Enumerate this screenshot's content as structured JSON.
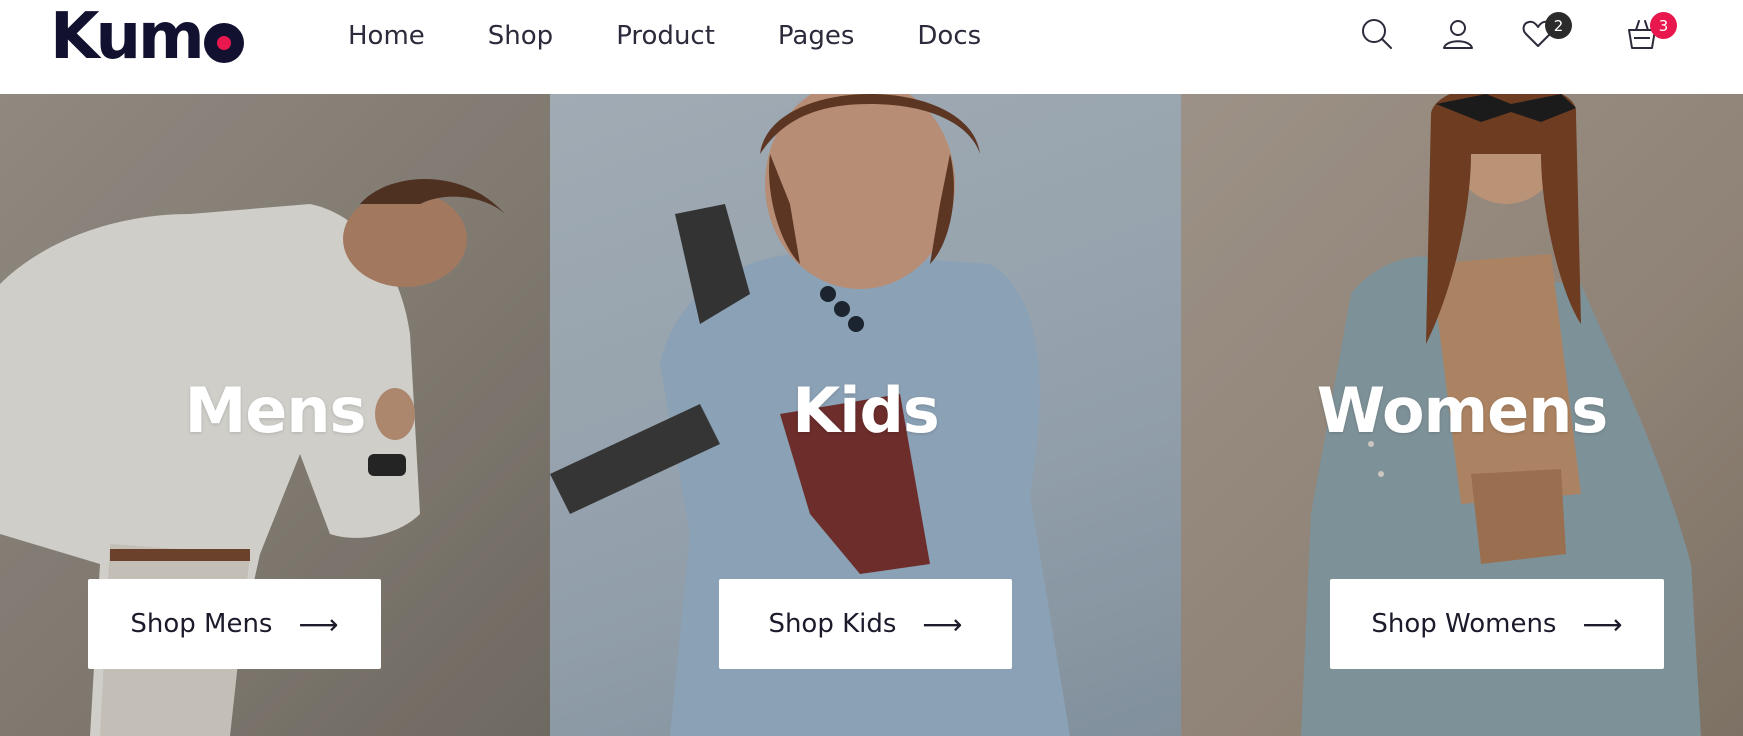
{
  "brand": {
    "logo_text": "Kum",
    "logo_dot_color": "#e8184e"
  },
  "nav": {
    "items": [
      "Home",
      "Shop",
      "Product",
      "Pages",
      "Docs"
    ]
  },
  "header_icons": {
    "search": "search-icon",
    "account": "user-icon",
    "wishlist": {
      "icon": "heart-icon",
      "count": "2",
      "badge_color": "#2b2b2b"
    },
    "cart": {
      "icon": "basket-icon",
      "count": "3",
      "badge_color": "#e8184e"
    }
  },
  "categories": [
    {
      "title": "Mens",
      "button_label": "Shop Mens",
      "arrow": "⟶"
    },
    {
      "title": "Kids",
      "button_label": "Shop Kids",
      "arrow": "⟶"
    },
    {
      "title": "Womens",
      "button_label": "Shop Womens",
      "arrow": "⟶"
    }
  ]
}
